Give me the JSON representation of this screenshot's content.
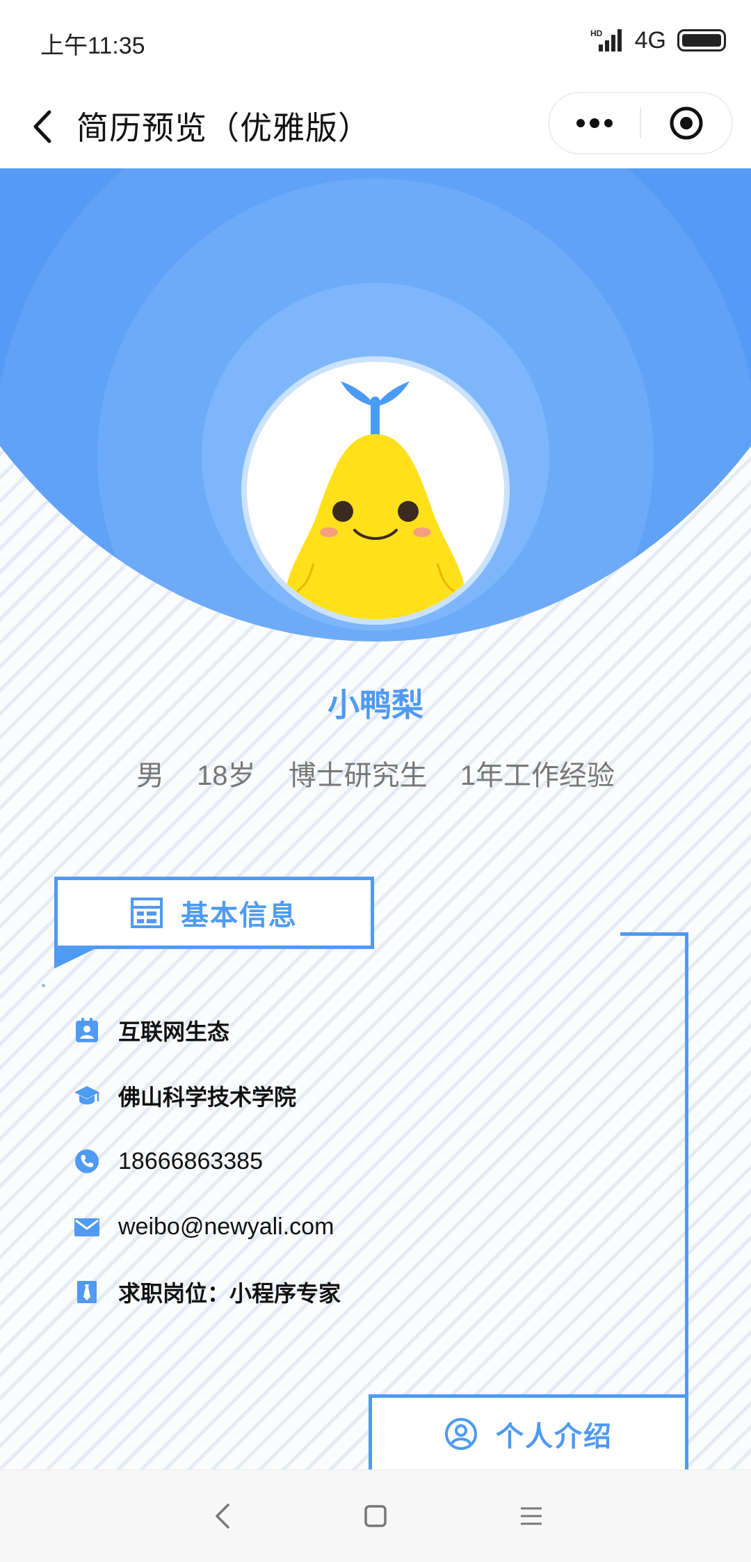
{
  "status_bar": {
    "time": "上午11:35",
    "network": "4G"
  },
  "nav": {
    "title": "简历预览（优雅版）"
  },
  "profile": {
    "name": "小鸭梨",
    "gender": "男",
    "age": "18岁",
    "education": "博士研究生",
    "experience": "1年工作经验"
  },
  "basic_section": {
    "title": "基本信息",
    "items": [
      {
        "icon": "id-badge-icon",
        "text": "互联网生态"
      },
      {
        "icon": "graduation-cap-icon",
        "text": "佛山科学技术学院"
      },
      {
        "icon": "phone-icon",
        "text": "18666863385"
      },
      {
        "icon": "mail-icon",
        "text": "weibo@newyali.com"
      },
      {
        "icon": "tie-icon",
        "text": "求职岗位：小程序专家"
      }
    ]
  },
  "intro_section": {
    "title": "个人介绍"
  },
  "colors": {
    "accent": "#4f9af2",
    "hero": "#559bf5",
    "avatar_face": "#ffe01b"
  }
}
